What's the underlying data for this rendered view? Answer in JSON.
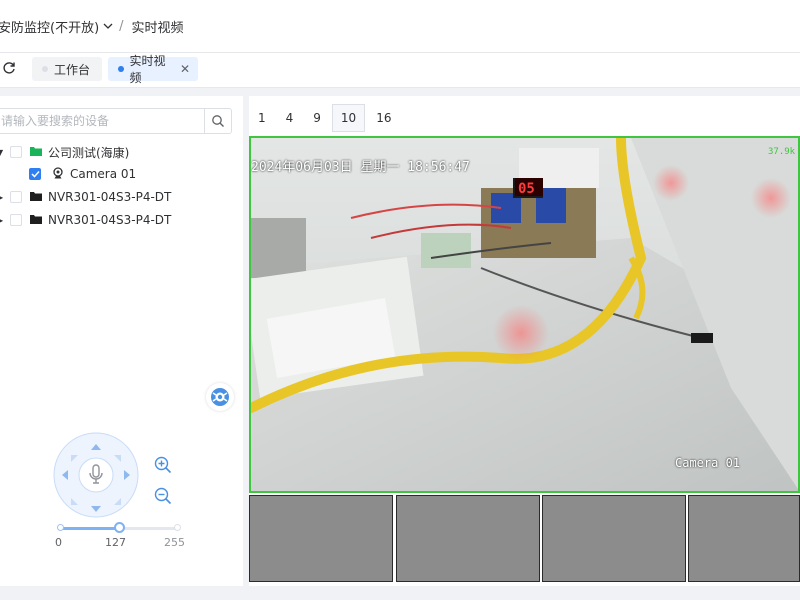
{
  "header": {
    "breadcrumb_main": "安防监控(不开放)",
    "breadcrumb_current": "实时视频"
  },
  "tabs": [
    {
      "label": "工作台",
      "active": false
    },
    {
      "label": "实时视频",
      "active": true
    }
  ],
  "colors": {
    "accent": "#2f7ff0",
    "active_border": "#3fc53f",
    "folder_green": "#19b35a"
  },
  "device_tree": {
    "search_placeholder": "请输入要搜索的设备",
    "nodes": [
      {
        "label": "公司测试(海康)",
        "checked": false,
        "icon": "folder-green-icon"
      },
      {
        "label": "Camera 01",
        "checked": true,
        "icon": "webcam-icon"
      },
      {
        "label": "NVR301-04S3-P4-DT",
        "checked": false,
        "icon": "folder-black-icon"
      },
      {
        "label": "NVR301-04S3-P4-DT",
        "checked": false,
        "icon": "folder-black-icon"
      }
    ]
  },
  "ptz": {
    "speed_min": "0",
    "speed_value": "127",
    "speed_max": "255",
    "speed_fraction": 0.498
  },
  "layout_options": [
    "1",
    "4",
    "9",
    "10",
    "16"
  ],
  "layout_selected": "10",
  "video": {
    "osd_time": "2024年06月03日 星期一 18:56:47",
    "osd_name": "Camera 01",
    "osd_rate": "37.9k"
  }
}
